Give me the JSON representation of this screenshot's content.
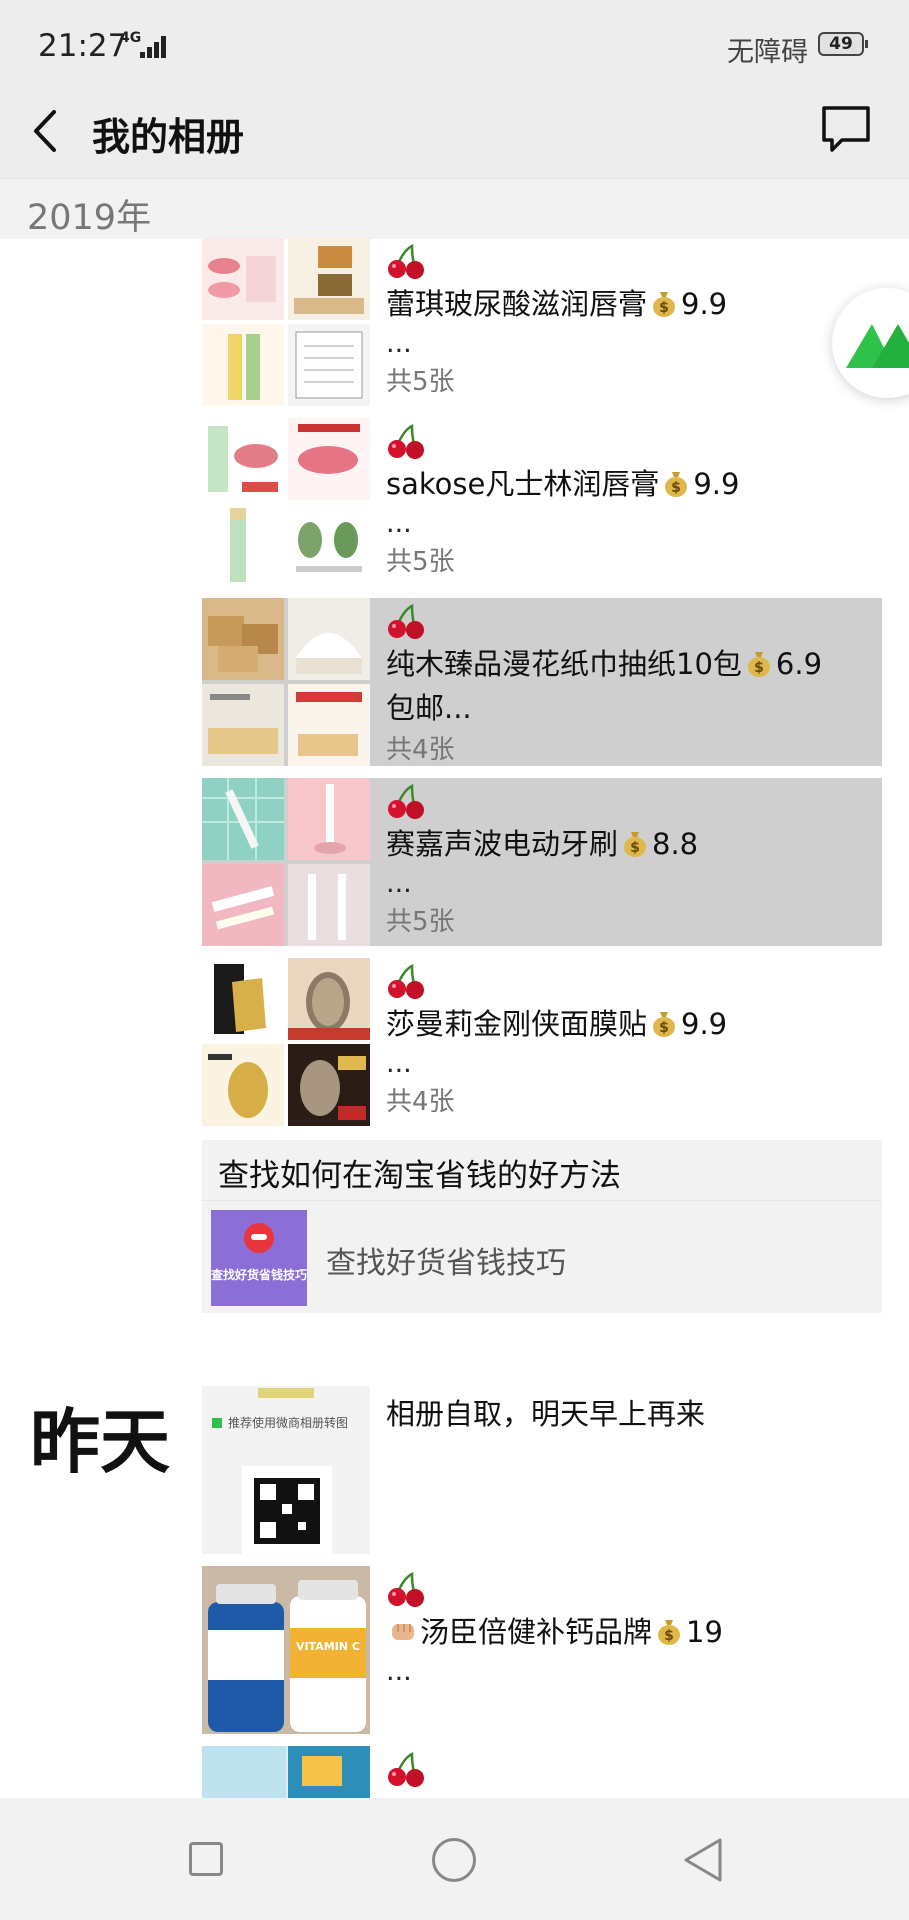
{
  "status_bar": {
    "time": "21:27",
    "network": "4G",
    "accessibility": "无障碍",
    "battery": "49"
  },
  "nav": {
    "title": "我的相册"
  },
  "year_header": "2019年",
  "posts": [
    {
      "caption": "蕾琪玻尿酸滋润唇膏",
      "price": "9.9",
      "ellipsis": "...",
      "count": "共5张"
    },
    {
      "caption": "sakose凡士林润唇膏",
      "price": "9.9",
      "ellipsis": "...",
      "count": "共5张"
    },
    {
      "caption": "纯木臻品漫花纸巾抽纸10包",
      "price": "6.9",
      "ellipsis": "包邮...",
      "count": "共4张"
    },
    {
      "caption": "赛嘉声波电动牙刷",
      "price": "8.8",
      "ellipsis": "...",
      "count": "共5张"
    },
    {
      "caption": "莎曼莉金刚侠面膜贴",
      "price": "9.9",
      "ellipsis": "...",
      "count": "共4张"
    }
  ],
  "ad": {
    "title": "查找如何在淘宝省钱的好方法",
    "thumb_text": "查找好货省钱技巧",
    "text": "查找好货省钱技巧"
  },
  "yesterday_label": "昨天",
  "yesterday_posts": [
    {
      "caption": "相册自取，明天早上再来",
      "thumb_text": "推荐使用微商相册转图"
    },
    {
      "caption": "汤臣倍健补钙品牌",
      "price": "19",
      "ellipsis": "...",
      "thumb_text": "VITAMIN C"
    }
  ],
  "colors": {
    "header_bg": "#ededed",
    "highlight": "#cfcfcf",
    "cherry": "#d4122e",
    "float_green": "#2ec24a"
  }
}
